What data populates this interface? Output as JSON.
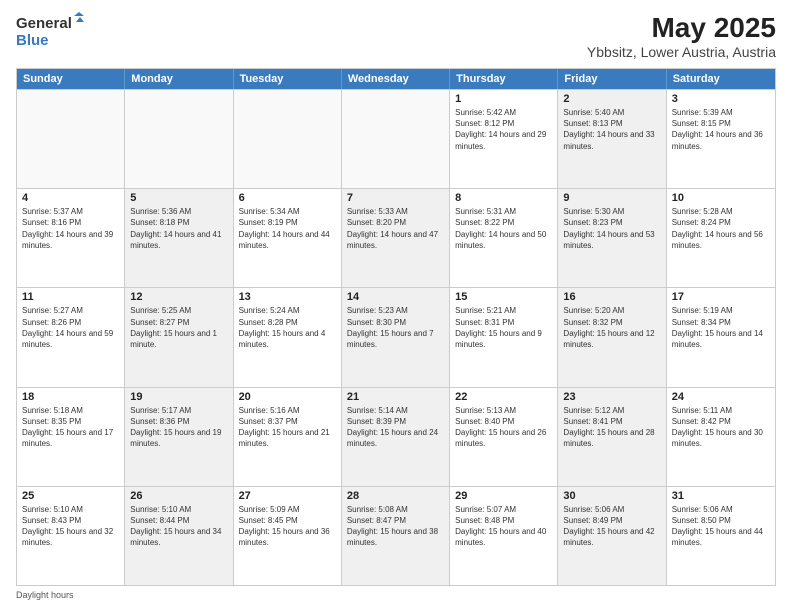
{
  "logo": {
    "line1": "General",
    "line2": "Blue"
  },
  "title": "May 2025",
  "subtitle": "Ybbsitz, Lower Austria, Austria",
  "days_of_week": [
    "Sunday",
    "Monday",
    "Tuesday",
    "Wednesday",
    "Thursday",
    "Friday",
    "Saturday"
  ],
  "weeks": [
    [
      {
        "num": "",
        "sunrise": "",
        "sunset": "",
        "daylight": "",
        "empty": true
      },
      {
        "num": "",
        "sunrise": "",
        "sunset": "",
        "daylight": "",
        "empty": true
      },
      {
        "num": "",
        "sunrise": "",
        "sunset": "",
        "daylight": "",
        "empty": true
      },
      {
        "num": "",
        "sunrise": "",
        "sunset": "",
        "daylight": "",
        "empty": true
      },
      {
        "num": "1",
        "sunrise": "5:42 AM",
        "sunset": "8:12 PM",
        "daylight": "14 hours and 29 minutes.",
        "empty": false,
        "shaded": false
      },
      {
        "num": "2",
        "sunrise": "5:40 AM",
        "sunset": "8:13 PM",
        "daylight": "14 hours and 33 minutes.",
        "empty": false,
        "shaded": true
      },
      {
        "num": "3",
        "sunrise": "5:39 AM",
        "sunset": "8:15 PM",
        "daylight": "14 hours and 36 minutes.",
        "empty": false,
        "shaded": false
      }
    ],
    [
      {
        "num": "4",
        "sunrise": "5:37 AM",
        "sunset": "8:16 PM",
        "daylight": "14 hours and 39 minutes.",
        "empty": false,
        "shaded": false
      },
      {
        "num": "5",
        "sunrise": "5:36 AM",
        "sunset": "8:18 PM",
        "daylight": "14 hours and 41 minutes.",
        "empty": false,
        "shaded": true
      },
      {
        "num": "6",
        "sunrise": "5:34 AM",
        "sunset": "8:19 PM",
        "daylight": "14 hours and 44 minutes.",
        "empty": false,
        "shaded": false
      },
      {
        "num": "7",
        "sunrise": "5:33 AM",
        "sunset": "8:20 PM",
        "daylight": "14 hours and 47 minutes.",
        "empty": false,
        "shaded": true
      },
      {
        "num": "8",
        "sunrise": "5:31 AM",
        "sunset": "8:22 PM",
        "daylight": "14 hours and 50 minutes.",
        "empty": false,
        "shaded": false
      },
      {
        "num": "9",
        "sunrise": "5:30 AM",
        "sunset": "8:23 PM",
        "daylight": "14 hours and 53 minutes.",
        "empty": false,
        "shaded": true
      },
      {
        "num": "10",
        "sunrise": "5:28 AM",
        "sunset": "8:24 PM",
        "daylight": "14 hours and 56 minutes.",
        "empty": false,
        "shaded": false
      }
    ],
    [
      {
        "num": "11",
        "sunrise": "5:27 AM",
        "sunset": "8:26 PM",
        "daylight": "14 hours and 59 minutes.",
        "empty": false,
        "shaded": false
      },
      {
        "num": "12",
        "sunrise": "5:25 AM",
        "sunset": "8:27 PM",
        "daylight": "15 hours and 1 minute.",
        "empty": false,
        "shaded": true
      },
      {
        "num": "13",
        "sunrise": "5:24 AM",
        "sunset": "8:28 PM",
        "daylight": "15 hours and 4 minutes.",
        "empty": false,
        "shaded": false
      },
      {
        "num": "14",
        "sunrise": "5:23 AM",
        "sunset": "8:30 PM",
        "daylight": "15 hours and 7 minutes.",
        "empty": false,
        "shaded": true
      },
      {
        "num": "15",
        "sunrise": "5:21 AM",
        "sunset": "8:31 PM",
        "daylight": "15 hours and 9 minutes.",
        "empty": false,
        "shaded": false
      },
      {
        "num": "16",
        "sunrise": "5:20 AM",
        "sunset": "8:32 PM",
        "daylight": "15 hours and 12 minutes.",
        "empty": false,
        "shaded": true
      },
      {
        "num": "17",
        "sunrise": "5:19 AM",
        "sunset": "8:34 PM",
        "daylight": "15 hours and 14 minutes.",
        "empty": false,
        "shaded": false
      }
    ],
    [
      {
        "num": "18",
        "sunrise": "5:18 AM",
        "sunset": "8:35 PM",
        "daylight": "15 hours and 17 minutes.",
        "empty": false,
        "shaded": false
      },
      {
        "num": "19",
        "sunrise": "5:17 AM",
        "sunset": "8:36 PM",
        "daylight": "15 hours and 19 minutes.",
        "empty": false,
        "shaded": true
      },
      {
        "num": "20",
        "sunrise": "5:16 AM",
        "sunset": "8:37 PM",
        "daylight": "15 hours and 21 minutes.",
        "empty": false,
        "shaded": false
      },
      {
        "num": "21",
        "sunrise": "5:14 AM",
        "sunset": "8:39 PM",
        "daylight": "15 hours and 24 minutes.",
        "empty": false,
        "shaded": true
      },
      {
        "num": "22",
        "sunrise": "5:13 AM",
        "sunset": "8:40 PM",
        "daylight": "15 hours and 26 minutes.",
        "empty": false,
        "shaded": false
      },
      {
        "num": "23",
        "sunrise": "5:12 AM",
        "sunset": "8:41 PM",
        "daylight": "15 hours and 28 minutes.",
        "empty": false,
        "shaded": true
      },
      {
        "num": "24",
        "sunrise": "5:11 AM",
        "sunset": "8:42 PM",
        "daylight": "15 hours and 30 minutes.",
        "empty": false,
        "shaded": false
      }
    ],
    [
      {
        "num": "25",
        "sunrise": "5:10 AM",
        "sunset": "8:43 PM",
        "daylight": "15 hours and 32 minutes.",
        "empty": false,
        "shaded": false
      },
      {
        "num": "26",
        "sunrise": "5:10 AM",
        "sunset": "8:44 PM",
        "daylight": "15 hours and 34 minutes.",
        "empty": false,
        "shaded": true
      },
      {
        "num": "27",
        "sunrise": "5:09 AM",
        "sunset": "8:45 PM",
        "daylight": "15 hours and 36 minutes.",
        "empty": false,
        "shaded": false
      },
      {
        "num": "28",
        "sunrise": "5:08 AM",
        "sunset": "8:47 PM",
        "daylight": "15 hours and 38 minutes.",
        "empty": false,
        "shaded": true
      },
      {
        "num": "29",
        "sunrise": "5:07 AM",
        "sunset": "8:48 PM",
        "daylight": "15 hours and 40 minutes.",
        "empty": false,
        "shaded": false
      },
      {
        "num": "30",
        "sunrise": "5:06 AM",
        "sunset": "8:49 PM",
        "daylight": "15 hours and 42 minutes.",
        "empty": false,
        "shaded": true
      },
      {
        "num": "31",
        "sunrise": "5:06 AM",
        "sunset": "8:50 PM",
        "daylight": "15 hours and 44 minutes.",
        "empty": false,
        "shaded": false
      }
    ]
  ],
  "footer": "Daylight hours"
}
